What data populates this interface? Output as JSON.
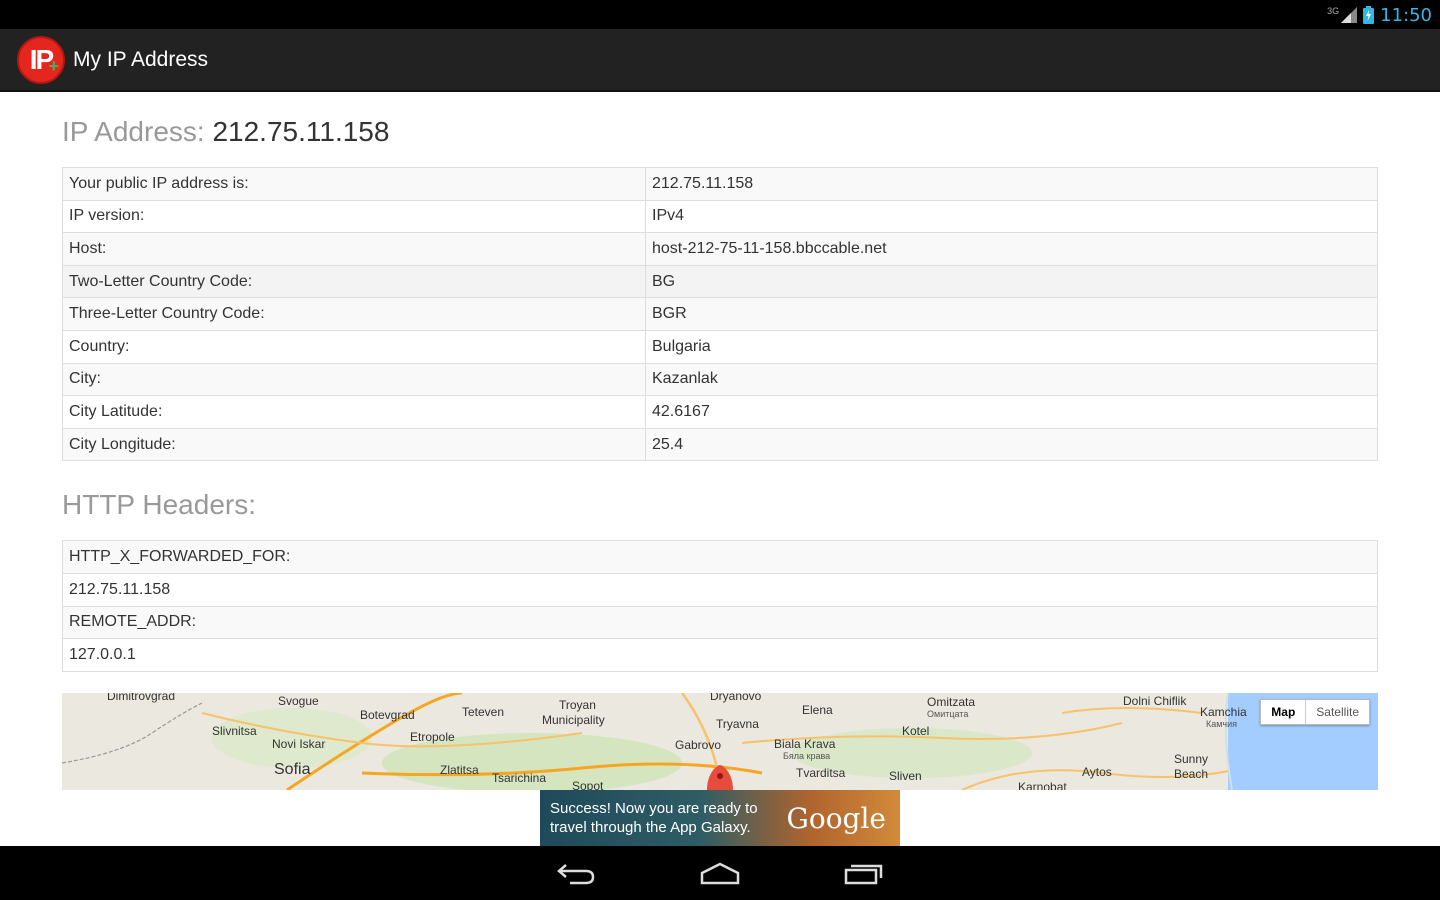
{
  "status_bar": {
    "time": "11:50",
    "network": "3G"
  },
  "app_bar": {
    "logo_text": "IP",
    "title": "My IP Address"
  },
  "ip_section": {
    "heading_label": "IP Address:",
    "heading_value": "212.75.11.158"
  },
  "info_rows": [
    {
      "label": "Your public IP address is:",
      "value": "212.75.11.158"
    },
    {
      "label": "IP version:",
      "value": "IPv4"
    },
    {
      "label": "Host:",
      "value": "host-212-75-11-158.bbccable.net"
    },
    {
      "label": "Two-Letter Country Code:",
      "value": "BG"
    },
    {
      "label": "Three-Letter Country Code:",
      "value": "BGR"
    },
    {
      "label": "Country:",
      "value": "Bulgaria"
    },
    {
      "label": "City:",
      "value": "Kazanlak"
    },
    {
      "label": "City Latitude:",
      "value": "42.6167"
    },
    {
      "label": "City Longitude:",
      "value": "25.4"
    }
  ],
  "http_section": {
    "heading": "HTTP Headers:"
  },
  "http_rows": [
    "HTTP_X_FORWARDED_FOR:",
    "212.75.11.158",
    "REMOTE_ADDR:",
    "127.0.0.1"
  ],
  "map": {
    "toggle_map": "Map",
    "toggle_satellite": "Satellite",
    "labels": [
      "Dimitrovgrad",
      "Svogue",
      "Botevgrad",
      "Teteven",
      "Troyan",
      "Municipality",
      "Dryanovo",
      "Elena",
      "Omitzata",
      "Омитцата",
      "Dolni Chiflik",
      "Kamchia",
      "Камчия",
      "Slivnitsa",
      "Novi Iskar",
      "Sofia",
      "Etropole",
      "Zlatitsa",
      "Tsarichina",
      "Sopot",
      "Gabrovo",
      "Tryavna",
      "Biala Krava",
      "Бяла крава",
      "Tvarditsa",
      "Kotel",
      "Sliven",
      "Aytos",
      "Sunny",
      "Beach",
      "Karnobat"
    ]
  },
  "ad": {
    "line1": "Success! Now you are ready to",
    "line2": "travel through the App Galaxy.",
    "brand": "Google"
  },
  "colors": {
    "accent": "#e5261f",
    "appbar": "#222222",
    "status_time": "#33b5e5"
  }
}
